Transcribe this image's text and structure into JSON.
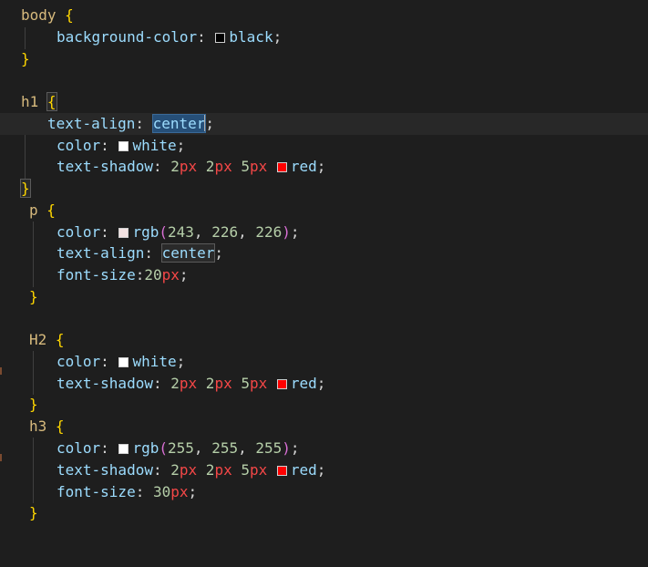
{
  "editor": {
    "language": "css",
    "colors": {
      "background": "#1e1e1e",
      "selector": "#d7ba7d",
      "property": "#9cdcfe",
      "number": "#b5cea8",
      "unit": "#f44747",
      "brace_gold": "#ffd700",
      "brace_purple": "#da70d6",
      "brace_blue": "#179fff",
      "swatch_black": "#000000",
      "swatch_white": "#ffffff",
      "swatch_red": "#ff0000",
      "swatch_rgb243": "#f3e2e2",
      "swatch_rgb255": "#ffffff"
    },
    "lines": {
      "l1": {
        "selector": "body",
        "brace": "{"
      },
      "l2": {
        "prop": "background-color",
        "colon": ":",
        "value": "black",
        "semi": ";"
      },
      "l3": {
        "brace": "}"
      },
      "l5": {
        "selector": "h1",
        "brace": "{"
      },
      "l6": {
        "prop": "text-align",
        "colon": ":",
        "value": "center",
        "semi": ";"
      },
      "l7": {
        "prop": "color",
        "colon": ":",
        "value": "white",
        "semi": ";"
      },
      "l8": {
        "prop": "text-shadow",
        "colon": ":",
        "n1": "2",
        "u1": "px",
        "n2": "2",
        "u2": "px",
        "n3": "5",
        "u3": "px",
        "value": "red",
        "semi": ";"
      },
      "l9": {
        "brace": "}"
      },
      "l10": {
        "selector": "p",
        "brace": "{"
      },
      "l11": {
        "prop": "color",
        "colon": ":",
        "fn": "rgb",
        "open": "(",
        "a": "243",
        "b": "226",
        "c": "226",
        "close": ")",
        "comma": ",",
        "semi": ";"
      },
      "l12": {
        "prop": "text-align",
        "colon": ":",
        "value": "center",
        "semi": ";"
      },
      "l13": {
        "prop": "font-size",
        "colon": ":",
        "n1": "20",
        "u1": "px",
        "semi": ";"
      },
      "l14": {
        "brace": "}"
      },
      "l16": {
        "selector": "H2",
        "brace": "{"
      },
      "l17": {
        "prop": "color",
        "colon": ":",
        "value": "white",
        "semi": ";"
      },
      "l18": {
        "prop": "text-shadow",
        "colon": ":",
        "n1": "2",
        "u1": "px",
        "n2": "2",
        "u2": "px",
        "n3": "5",
        "u3": "px",
        "value": "red",
        "semi": ";"
      },
      "l19": {
        "brace": "}"
      },
      "l20": {
        "selector": "h3",
        "brace": "{"
      },
      "l21": {
        "prop": "color",
        "colon": ":",
        "fn": "rgb",
        "open": "(",
        "a": "255",
        "b": "255",
        "c": "255",
        "close": ")",
        "comma": ",",
        "semi": ";"
      },
      "l22": {
        "prop": "text-shadow",
        "colon": ":",
        "n1": "2",
        "u1": "px",
        "n2": "2",
        "u2": "px",
        "n3": "5",
        "u3": "px",
        "value": "red",
        "semi": ";"
      },
      "l23": {
        "prop": "font-size",
        "colon": ":",
        "n1": "30",
        "u1": "px",
        "semi": ";"
      },
      "l24": {
        "brace": "}"
      }
    }
  }
}
